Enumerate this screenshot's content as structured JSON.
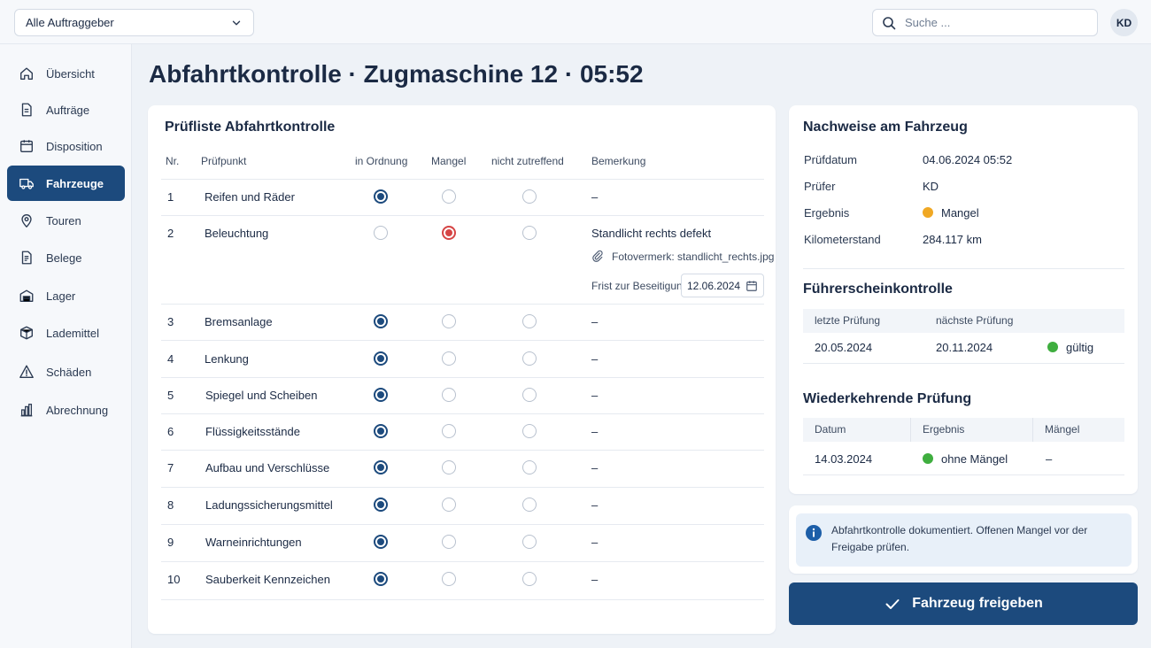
{
  "topbar": {
    "client_filter": "Alle Auftraggeber",
    "search_placeholder": "Suche ...",
    "user_initials": "KD"
  },
  "sidebar": {
    "items": [
      {
        "label": "Übersicht",
        "icon": "home-icon"
      },
      {
        "label": "Aufträge",
        "icon": "document-icon"
      },
      {
        "label": "Disposition",
        "icon": "calendar-icon"
      },
      {
        "label": "Fahrzeuge",
        "icon": "truck-icon",
        "active": true
      },
      {
        "label": "Touren",
        "icon": "map-pin-icon"
      },
      {
        "label": "Belege",
        "icon": "receipt-icon"
      },
      {
        "label": "Lager",
        "icon": "warehouse-icon"
      },
      {
        "label": "Lademittel",
        "icon": "box-icon"
      },
      {
        "label": "Schäden",
        "icon": "warning-icon"
      },
      {
        "label": "Abrechnung",
        "icon": "bar-chart-icon"
      }
    ]
  },
  "page": {
    "title": "Abfahrtkontrolle · Zugmaschine 12 · 05:52"
  },
  "checklist": {
    "title": "Prüfliste Abfahrtkontrolle",
    "columns": {
      "nr": "Nr.",
      "item": "Prüfpunkt",
      "ok": "in Ordnung",
      "defect": "Mangel",
      "na": "nicht zutreffend",
      "remark": "Bemerkung"
    },
    "rows": [
      {
        "nr": "1",
        "item": "Reifen und Räder",
        "status": "ok",
        "remark": "–"
      },
      {
        "nr": "2",
        "item": "Beleuchtung",
        "status": "defect",
        "remark": "Standlicht rechts defekt",
        "photo_note": "Fotovermerk: standlicht_rechts.jpg",
        "deadline_label": "Frist zur Beseitigung",
        "deadline": "12.06.2024"
      },
      {
        "nr": "3",
        "item": "Bremsanlage",
        "status": "ok",
        "remark": "–"
      },
      {
        "nr": "4",
        "item": "Lenkung",
        "status": "ok",
        "remark": "–"
      },
      {
        "nr": "5",
        "item": "Spiegel und Scheiben",
        "status": "ok",
        "remark": "–"
      },
      {
        "nr": "6",
        "item": "Flüssigkeitsstände",
        "status": "ok",
        "remark": "–"
      },
      {
        "nr": "7",
        "item": "Aufbau und Verschlüsse",
        "status": "ok",
        "remark": "–"
      },
      {
        "nr": "8",
        "item": "Ladungssicherungsmittel",
        "status": "ok",
        "remark": "–"
      },
      {
        "nr": "9",
        "item": "Warneinrichtungen",
        "status": "ok",
        "remark": "–"
      },
      {
        "nr": "10",
        "item": "Sauberkeit Kennzeichen",
        "status": "ok",
        "remark": "–"
      }
    ]
  },
  "evidence": {
    "title": "Nachweise am Fahrzeug",
    "fields": [
      {
        "label": "Prüfdatum",
        "value": "04.06.2024 05:52"
      },
      {
        "label": "Prüfer",
        "value": "KD"
      },
      {
        "label": "Ergebnis",
        "value": "Mangel"
      },
      {
        "label": "Kilometerstand",
        "value": "284.117 km"
      }
    ],
    "result_color": "#f0a824",
    "license": {
      "title": "Führerscheinkontrolle",
      "last_label": "letzte Prüfung",
      "next_label": "nächste Prüfung",
      "last": "20.05.2024",
      "next": "20.11.2024",
      "status": "gültig",
      "status_color": "#3fae3f"
    },
    "periodic": {
      "title": "Wiederkehrende Prüfung",
      "date_label": "Datum",
      "result_label": "Ergebnis",
      "defects_label": "Mängel",
      "date": "14.03.2024",
      "result": "ohne Mängel",
      "defects": "–",
      "result_color": "#3fae3f"
    }
  },
  "notice": {
    "text": "Abfahrtkontrolle dokumentiert. Offenen Mangel vor der Freigabe prüfen."
  },
  "actions": {
    "release_label": "Fahrzeug freigeben"
  },
  "colors": {
    "primary": "#1c4a7d",
    "defect": "#d64545",
    "warning": "#f0a824",
    "success": "#3fae3f"
  }
}
